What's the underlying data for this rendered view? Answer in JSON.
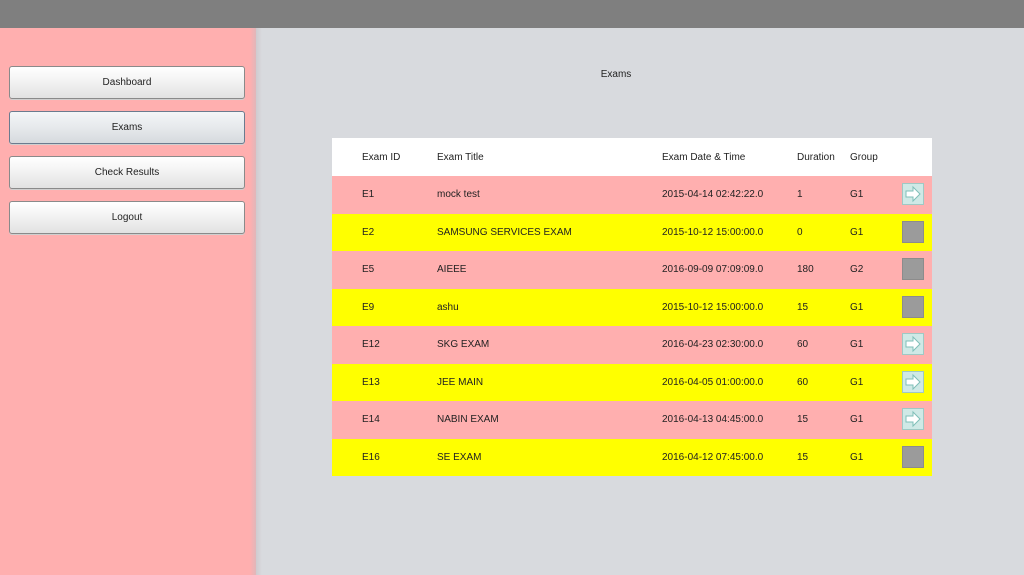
{
  "sidebar": {
    "items": [
      {
        "label": "Dashboard"
      },
      {
        "label": "Exams"
      },
      {
        "label": "Check Results"
      },
      {
        "label": "Logout"
      }
    ]
  },
  "main": {
    "title": "Exams",
    "table": {
      "headers": {
        "id": "Exam ID",
        "title": "Exam Title",
        "date": "Exam Date & Time",
        "duration": "Duration",
        "group": "Group"
      },
      "rows": [
        {
          "id": "E1",
          "title": "mock test",
          "date": "2015-04-14 02:42:22.0",
          "duration": "1",
          "group": "G1",
          "action": "arrow-right-icon",
          "color": "#ffafaf"
        },
        {
          "id": "E2",
          "title": "SAMSUNG SERVICES EXAM",
          "date": "2015-10-12 15:00:00.0",
          "duration": "0",
          "group": "G1",
          "action": "disabled-icon",
          "color": "#ffff00"
        },
        {
          "id": "E5",
          "title": "AIEEE",
          "date": "2016-09-09 07:09:09.0",
          "duration": "180",
          "group": "G2",
          "action": "disabled-icon",
          "color": "#ffafaf"
        },
        {
          "id": "E9",
          "title": "ashu",
          "date": "2015-10-12 15:00:00.0",
          "duration": "15",
          "group": "G1",
          "action": "disabled-icon",
          "color": "#ffff00"
        },
        {
          "id": "E12",
          "title": "SKG EXAM",
          "date": "2016-04-23 02:30:00.0",
          "duration": "60",
          "group": "G1",
          "action": "arrow-right-icon",
          "color": "#ffafaf"
        },
        {
          "id": "E13",
          "title": "JEE MAIN",
          "date": "2016-04-05 01:00:00.0",
          "duration": "60",
          "group": "G1",
          "action": "arrow-right-icon",
          "color": "#ffff00"
        },
        {
          "id": "E14",
          "title": "NABIN EXAM",
          "date": "2016-04-13 04:45:00.0",
          "duration": "15",
          "group": "G1",
          "action": "arrow-right-icon",
          "color": "#ffafaf"
        },
        {
          "id": "E16",
          "title": "SE EXAM",
          "date": "2016-04-12 07:45:00.0",
          "duration": "15",
          "group": "G1",
          "action": "disabled-icon",
          "color": "#ffff00"
        }
      ]
    }
  },
  "colors": {
    "topbar": "#7f7f7f",
    "sidebar": "#ffafaf",
    "content": "#d8dade",
    "row_pink": "#ffafaf",
    "row_yellow": "#ffff00"
  }
}
